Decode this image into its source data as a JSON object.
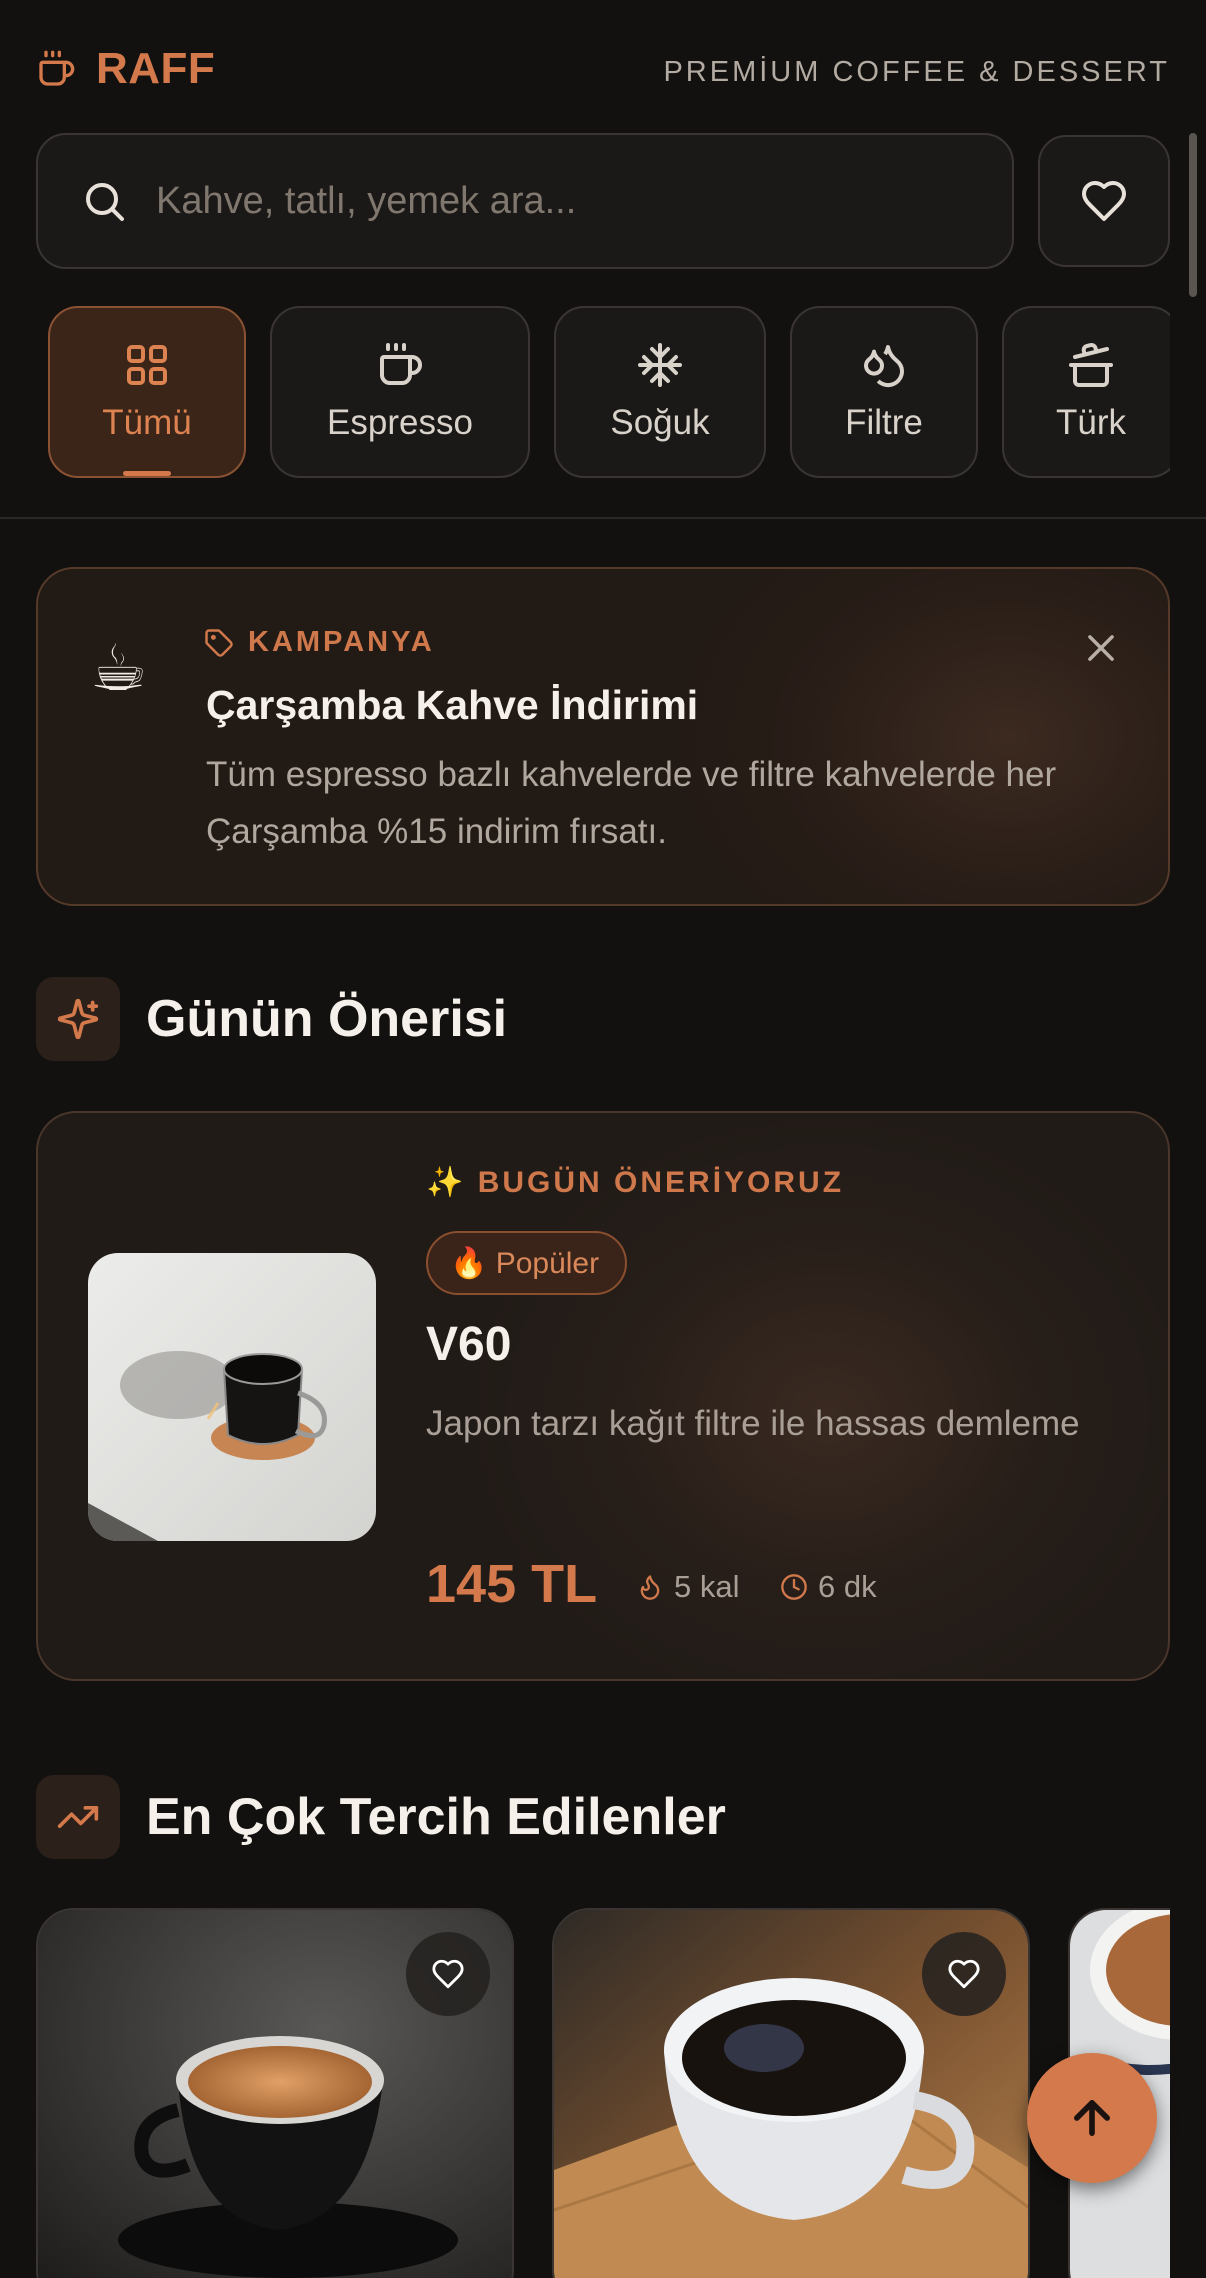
{
  "brand": {
    "name": "RAFF",
    "tagline": "PREMİUM COFFEE & DESSERT",
    "logo_icon": "coffee-cup-icon"
  },
  "search": {
    "placeholder": "Kahve, tatlı, yemek ara...",
    "value": ""
  },
  "categories": [
    {
      "label": "Tümü",
      "icon": "grid-icon",
      "active": true
    },
    {
      "label": "Espresso",
      "icon": "coffee-cup-icon",
      "active": false
    },
    {
      "label": "Soğuk",
      "icon": "snowflake-icon",
      "active": false
    },
    {
      "label": "Filtre",
      "icon": "droplets-icon",
      "active": false
    },
    {
      "label": "Türk",
      "icon": "cezve-icon",
      "active": false
    }
  ],
  "campaign": {
    "emoji": "☕",
    "tag": "KAMPANYA",
    "title": "Çarşamba Kahve İndirimi",
    "description": "Tüm espresso bazlı kahvelerde ve filtre kahvelerde her Çarşamba %15 indirim fırsatı."
  },
  "recommendation": {
    "section_title": "Günün Önerisi",
    "eyebrow": "✨ BUGÜN ÖNERİYORUZ",
    "badge": "🔥 Popüler",
    "name": "V60",
    "description": "Japon tarzı kağıt filtre ile hassas demleme",
    "price": "145 TL",
    "calories": "5 kal",
    "time": "6 dk"
  },
  "popular": {
    "section_title": "En Çok Tercih Edilenler",
    "items": [
      {
        "image": "espresso-cup-photo"
      },
      {
        "image": "coffee-cup-on-board-photo"
      },
      {
        "image": "latte-photo"
      }
    ]
  },
  "colors": {
    "accent": "#d3794b",
    "background": "#121110",
    "surface": "#1b1917",
    "border": "#3a3532"
  }
}
